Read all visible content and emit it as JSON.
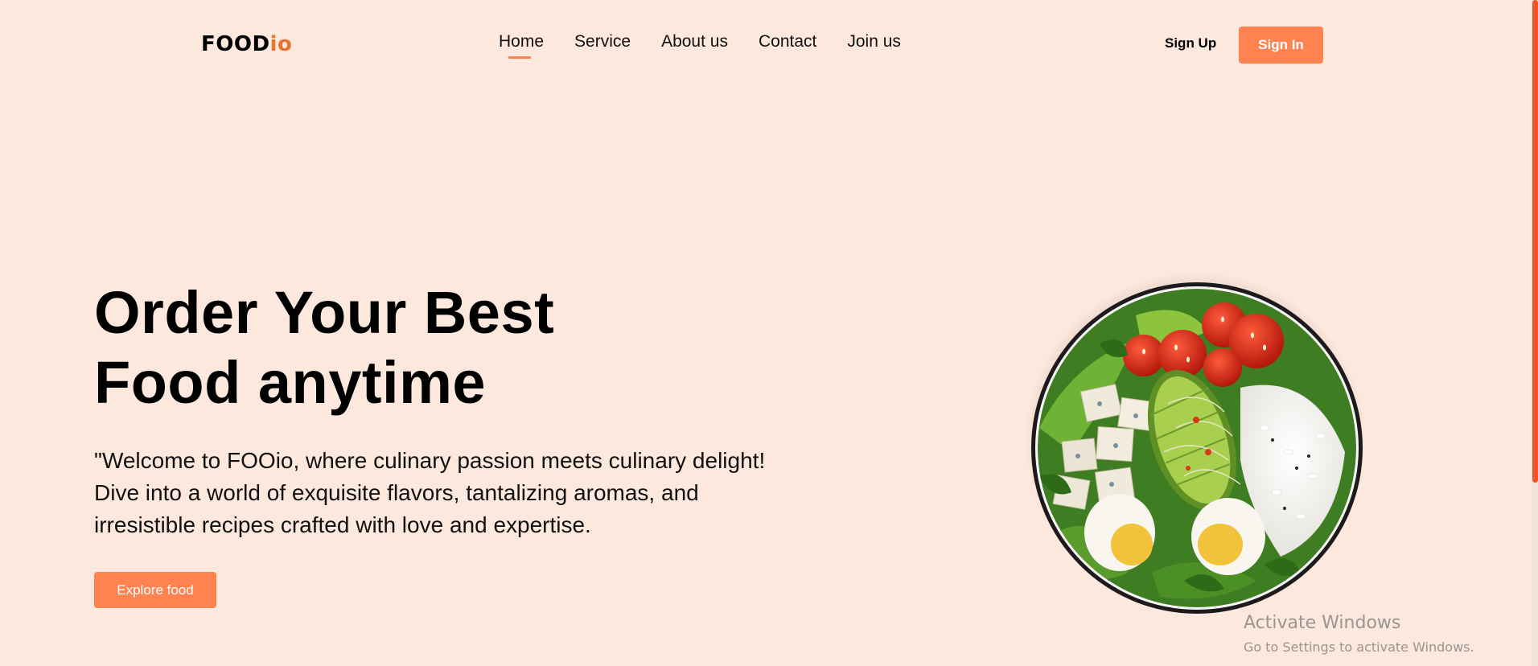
{
  "header": {
    "logo": {
      "main": "FOOD",
      "accent": "io"
    },
    "nav": [
      {
        "label": "Home",
        "active": true
      },
      {
        "label": "Service",
        "active": false
      },
      {
        "label": "About us",
        "active": false
      },
      {
        "label": "Contact",
        "active": false
      },
      {
        "label": "Join us",
        "active": false
      }
    ],
    "signup_label": "Sign Up",
    "signin_label": "Sign In"
  },
  "hero": {
    "title_line1": "Order Your Best",
    "title_line2": "Food anytime",
    "description": "\"Welcome to FOOio, where culinary passion meets culinary delight! Dive into a world of exquisite flavors, tantalizing aromas, and irresistible recipes crafted with love and expertise.",
    "cta_label": "Explore food"
  },
  "watermark": {
    "title": "Activate Windows",
    "subtitle": "Go to Settings to activate Windows."
  },
  "colors": {
    "background": "#fde8dd",
    "accent": "#ff8350",
    "logo_accent": "#e8742f",
    "scrollbar": "#f05423"
  },
  "icons": {
    "hero_image": "salad-bowl-image"
  }
}
